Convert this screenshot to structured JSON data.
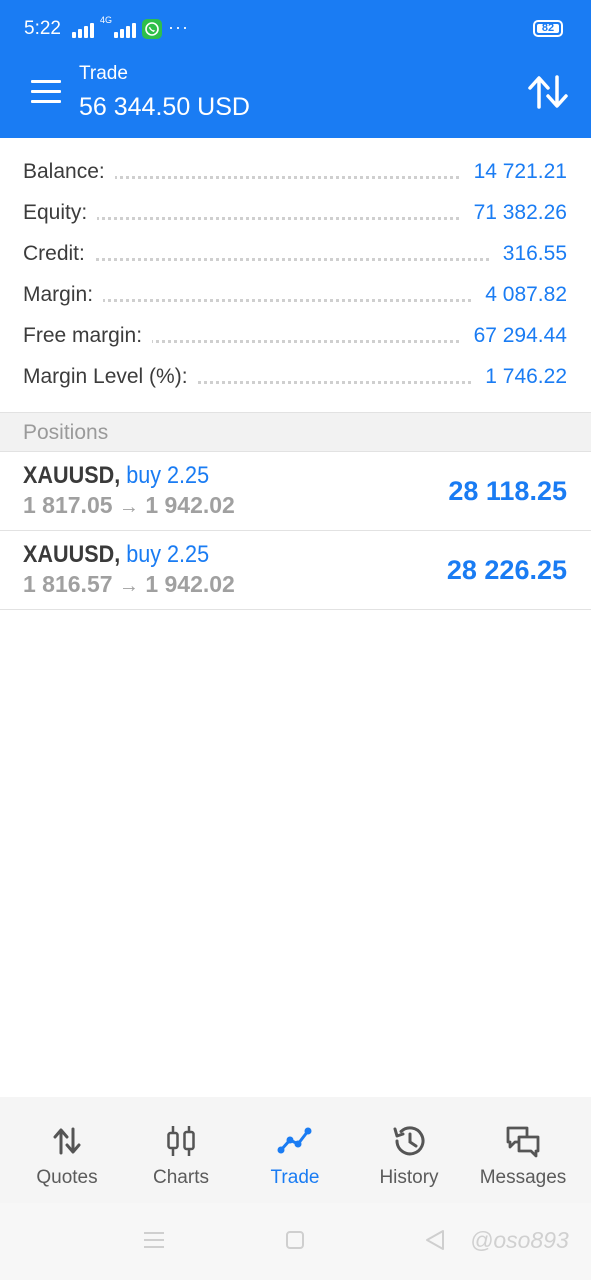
{
  "status_bar": {
    "time": "5:22",
    "network": "4G",
    "battery": "82",
    "more": "···"
  },
  "header": {
    "title": "Trade",
    "total": "56 344.50 USD",
    "background": "#1a7cf3"
  },
  "summary": [
    {
      "label": "Balance:",
      "value": "14 721.21"
    },
    {
      "label": "Equity:",
      "value": "71 382.26"
    },
    {
      "label": "Credit:",
      "value": "316.55"
    },
    {
      "label": "Margin:",
      "value": "4 087.82"
    },
    {
      "label": "Free margin:",
      "value": "67 294.44"
    },
    {
      "label": "Margin Level (%):",
      "value": "1 746.22"
    }
  ],
  "positions_header": "Positions",
  "positions": [
    {
      "symbol": "XAUUSD,",
      "side": "buy 2.25",
      "open_price": "1 817.05",
      "arrow": "→",
      "current_price": "1 942.02",
      "profit": "28 118.25"
    },
    {
      "symbol": "XAUUSD,",
      "side": "buy 2.25",
      "open_price": "1 816.57",
      "arrow": "→",
      "current_price": "1 942.02",
      "profit": "28 226.25"
    }
  ],
  "tabs": [
    {
      "label": "Quotes",
      "icon": "quotes-arrows-icon"
    },
    {
      "label": "Charts",
      "icon": "charts-candles-icon"
    },
    {
      "label": "Trade",
      "icon": "trade-line-icon",
      "active": true
    },
    {
      "label": "History",
      "icon": "history-clock-icon"
    },
    {
      "label": "Messages",
      "icon": "messages-bubbles-icon"
    }
  ],
  "watermark": "@oso893",
  "colors": {
    "accent": "#1a7cf3",
    "text": "#3a3a3a",
    "muted": "#a0a0a0"
  }
}
